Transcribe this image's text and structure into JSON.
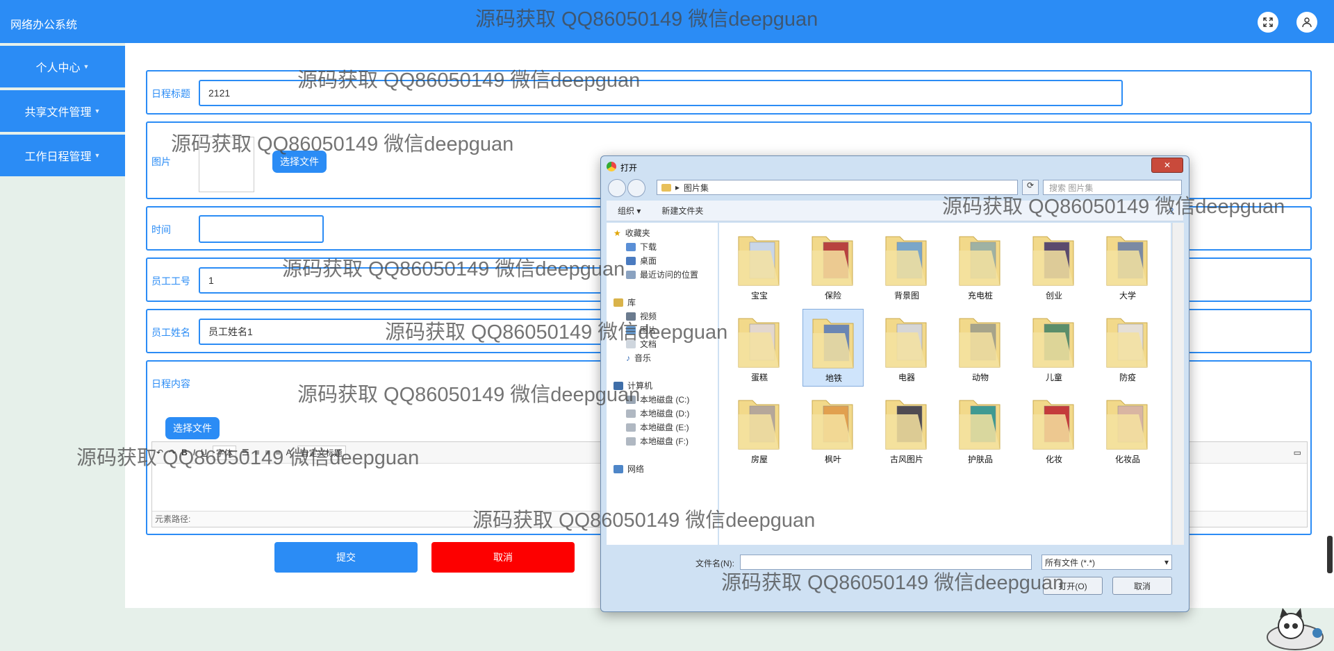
{
  "app": {
    "title": "网络办公系统"
  },
  "header_icons": {
    "fullscreen": "expand-icon",
    "user": "user-icon"
  },
  "sidebar": {
    "items": [
      {
        "label": "个人中心"
      },
      {
        "label": "共享文件管理"
      },
      {
        "label": "工作日程管理"
      }
    ]
  },
  "form": {
    "title_label": "日程标题",
    "title_value": "2121",
    "image_label": "图片",
    "choose_file": "选择文件",
    "time_label": "时间",
    "time_value": "",
    "emp_no_label": "员工工号",
    "emp_no_value": "1",
    "emp_name_label": "员工姓名",
    "emp_name_value": "员工姓名1",
    "content_label": "日程内容",
    "content_choose_file": "选择文件",
    "editor_font_select": "字体",
    "editor_heading_select": "自定义标题",
    "editor_path": "元素路径:",
    "submit": "提交",
    "cancel": "取消"
  },
  "dialog": {
    "title": "打开",
    "close": "✕",
    "address": "图片集",
    "search_placeholder": "搜索 图片集",
    "organize": "组织 ▾",
    "new_folder": "新建文件夹",
    "nav": {
      "favorites": "收藏夹",
      "downloads": "下载",
      "desktop": "桌面",
      "recent": "最近访问的位置",
      "libraries": "库",
      "videos": "视频",
      "pictures": "图片",
      "documents": "文档",
      "music": "音乐",
      "computer": "计算机",
      "disk_c": "本地磁盘 (C:)",
      "disk_d": "本地磁盘 (D:)",
      "disk_e": "本地磁盘 (E:)",
      "disk_f": "本地磁盘 (F:)",
      "network": "网络"
    },
    "folders": [
      "宝宝",
      "保险",
      "背景图",
      "充电桩",
      "创业",
      "大学",
      "蛋糕",
      "地铁",
      "电器",
      "动物",
      "儿童",
      "防疫",
      "房屋",
      "枫叶",
      "古风图片",
      "护肤品",
      "化妆",
      "化妆品"
    ],
    "selected_folder": "地铁",
    "filename_label": "文件名(N):",
    "filetype": "所有文件 (*.*)",
    "open_button": "打开(O)",
    "cancel_button": "取消"
  },
  "watermark": "源码获取 QQ86050149 微信deepguan"
}
